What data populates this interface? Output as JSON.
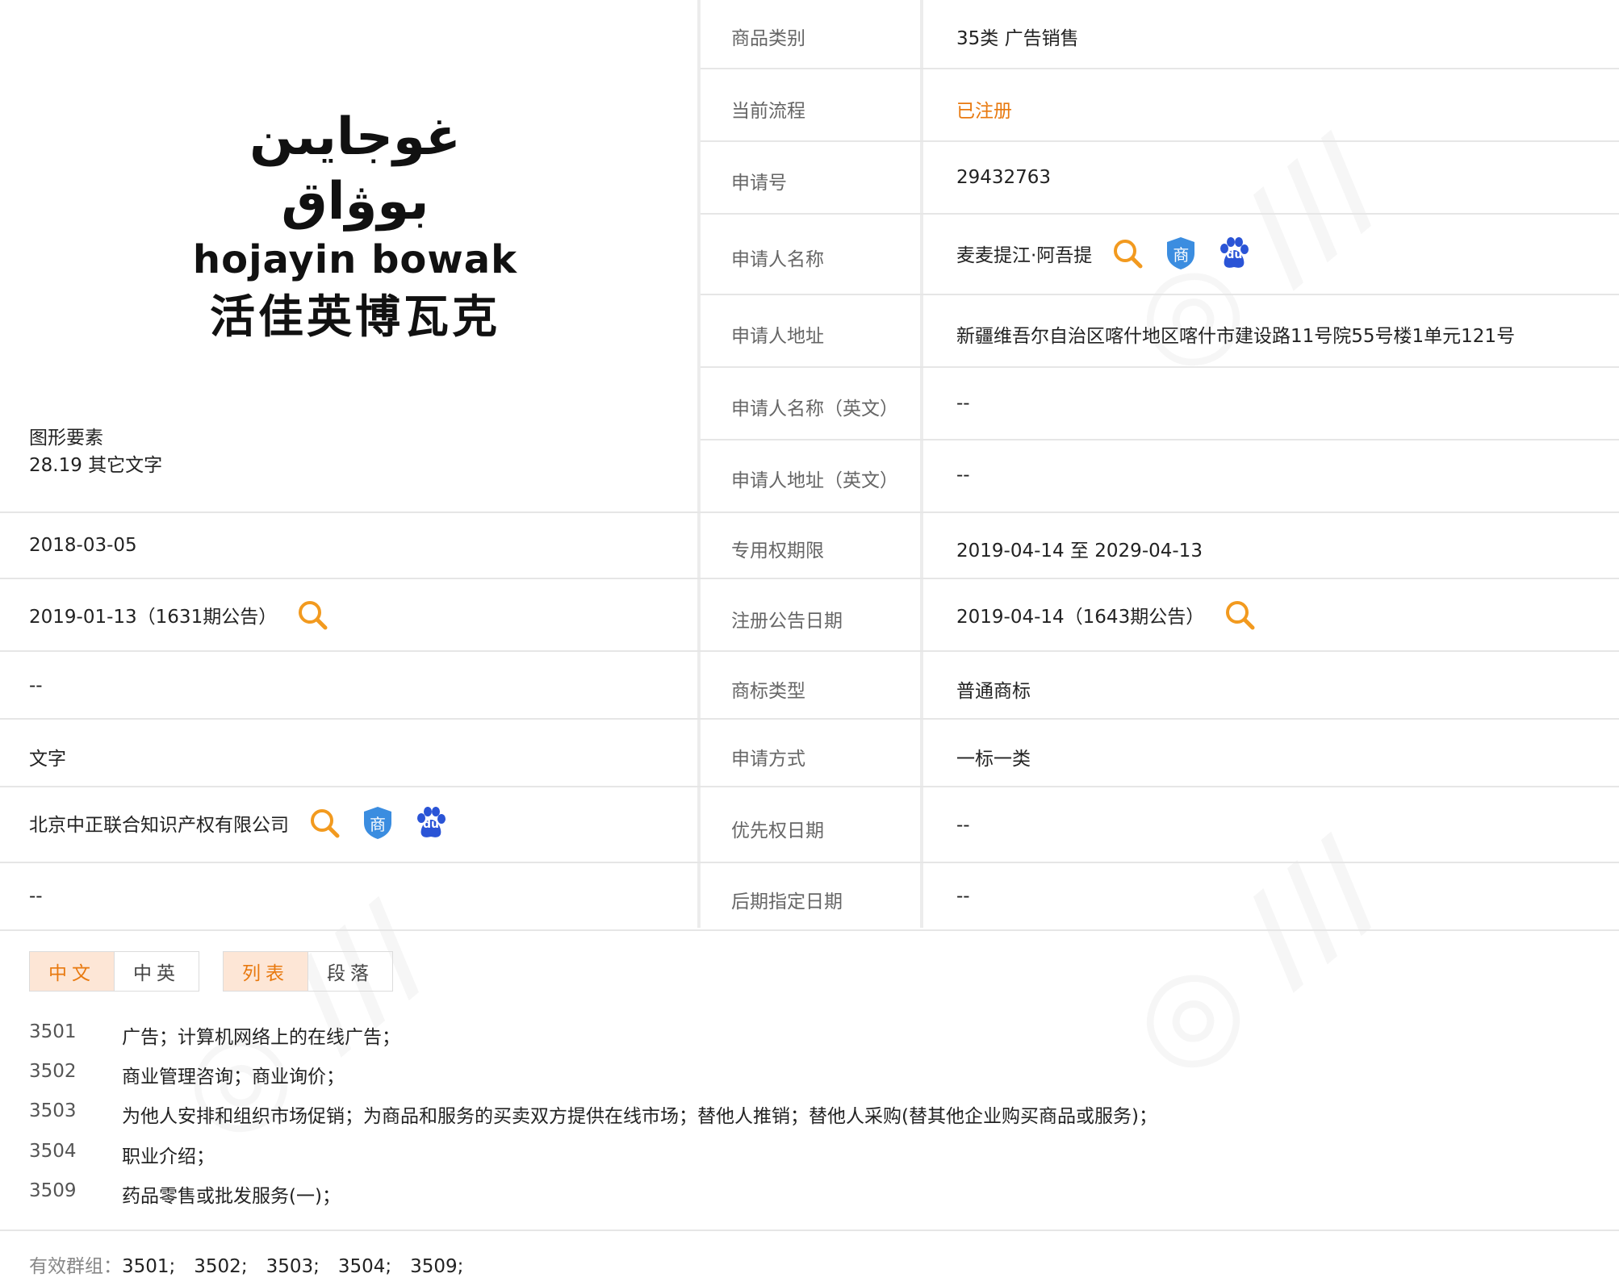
{
  "logo": {
    "uyghur": "غوجايىن بوۋاق",
    "latin": "hojayin bowak",
    "chinese": "活佳英博瓦克"
  },
  "figure": {
    "label": "图形要素",
    "value": "28.19 其它文字"
  },
  "right_rows": [
    {
      "label": "商品类别",
      "value": "35类 广告销售"
    },
    {
      "label": "当前流程",
      "value": "已注册"
    },
    {
      "label": "申请号",
      "value": "29432763"
    },
    {
      "label": "申请人名称",
      "value": "麦麦提江·阿吾提"
    },
    {
      "label": "申请人地址",
      "value": "新疆维吾尔自治区喀什地区喀什市建设路11号院55号楼1单元121号"
    },
    {
      "label": "申请人名称（英文）",
      "value": "--"
    },
    {
      "label": "申请人地址（英文）",
      "value": "--"
    },
    {
      "label": "专用权期限",
      "value": "2019-04-14 至 2029-04-13"
    },
    {
      "label": "注册公告日期",
      "value": "2019-04-14（1643期公告）"
    },
    {
      "label": "商标类型",
      "value": "普通商标"
    },
    {
      "label": "申请方式",
      "value": "一标一类"
    },
    {
      "label": "优先权日期",
      "value": "--"
    },
    {
      "label": "后期指定日期",
      "value": "--"
    }
  ],
  "left_rows": [
    {
      "value": "2018-03-05"
    },
    {
      "value": "2019-01-13（1631期公告）"
    },
    {
      "value": "--"
    },
    {
      "value": "文字"
    },
    {
      "value": "北京中正联合知识产权有限公司"
    },
    {
      "value": "--"
    }
  ],
  "tabs": {
    "lang": [
      "中文",
      "中英"
    ],
    "view": [
      "列表",
      "段落"
    ]
  },
  "services": [
    {
      "code": "3501",
      "desc": "广告；计算机网络上的在线广告；"
    },
    {
      "code": "3502",
      "desc": "商业管理咨询；商业询价；"
    },
    {
      "code": "3503",
      "desc": "为他人安排和组织市场促销；为商品和服务的买卖双方提供在线市场；替他人推销；替他人采购(替其他企业购买商品或服务)；"
    },
    {
      "code": "3504",
      "desc": "职业介绍；"
    },
    {
      "code": "3509",
      "desc": "药品零售或批发服务(一)；"
    }
  ],
  "valid_groups": {
    "label": "有效群组：",
    "value": "3501;　3502;　3503;　3504;　3509;"
  },
  "icons": {
    "search": "search-icon",
    "shang": "trademark-shield-icon",
    "shang_char": "商",
    "baidu": "baidu-paw-icon",
    "baidu_text": "du"
  },
  "colors": {
    "accent": "#e8790f",
    "search": "#f29a1f",
    "shield": "#3b8de0",
    "baidu": "#2a54d6"
  }
}
